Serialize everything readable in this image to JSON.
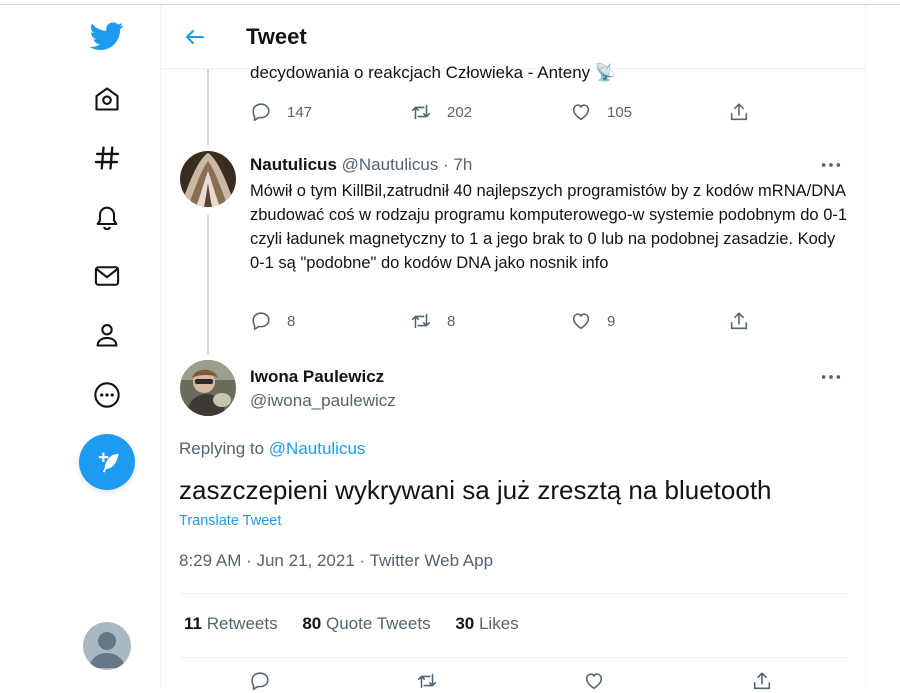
{
  "header": {
    "title": "Tweet"
  },
  "sidebar": {
    "items": [
      {
        "icon": "twitter-logo-icon"
      },
      {
        "icon": "home-icon"
      },
      {
        "icon": "hashtag-icon"
      },
      {
        "icon": "bell-icon"
      },
      {
        "icon": "mail-icon"
      },
      {
        "icon": "profile-icon"
      },
      {
        "icon": "more-circle-icon"
      }
    ],
    "compose_icon": "feather-plus-icon"
  },
  "previous_tweet": {
    "text_tail": "decydowania o reakcjach Człowieka - Anteny 📡",
    "replies": "147",
    "retweets": "202",
    "likes": "105"
  },
  "reply_tweet": {
    "name": "Nautulicus",
    "handle_time": "@Nautulicus · 7h",
    "body": "Mówił o tym KillBil,zatrudnił 40 najlepszych programistów by z kodów mRNA/DNA zbudować coś w rodzaju programu komputerowego-w systemie podobnym do 0-1 czyli ładunek magnetyczny to 1 a jego brak to 0 lub na podobnej zasadzie. Kody 0-1 są \"podobne\" do kodów DNA jako nosnik info",
    "replies": "8",
    "retweets": "8",
    "likes": "9"
  },
  "focused_tweet": {
    "name": "Iwona Paulewicz",
    "handle": "@iwona_paulewicz",
    "replying_prefix": "Replying to ",
    "replying_to": "@Nautulicus",
    "text": "zaszczepieni wykrywani sa już zresztą na bluetooth",
    "translate": "Translate Tweet",
    "meta": "8:29 AM · Jun 21, 2021 · Twitter Web App",
    "retweets_count": "11",
    "retweets_label": "Retweets",
    "quotes_count": "80",
    "quotes_label": "Quote Tweets",
    "likes_count": "30",
    "likes_label": "Likes"
  },
  "colors": {
    "accent": "#1d9bf0",
    "muted": "#536471",
    "text": "#0f1419"
  }
}
